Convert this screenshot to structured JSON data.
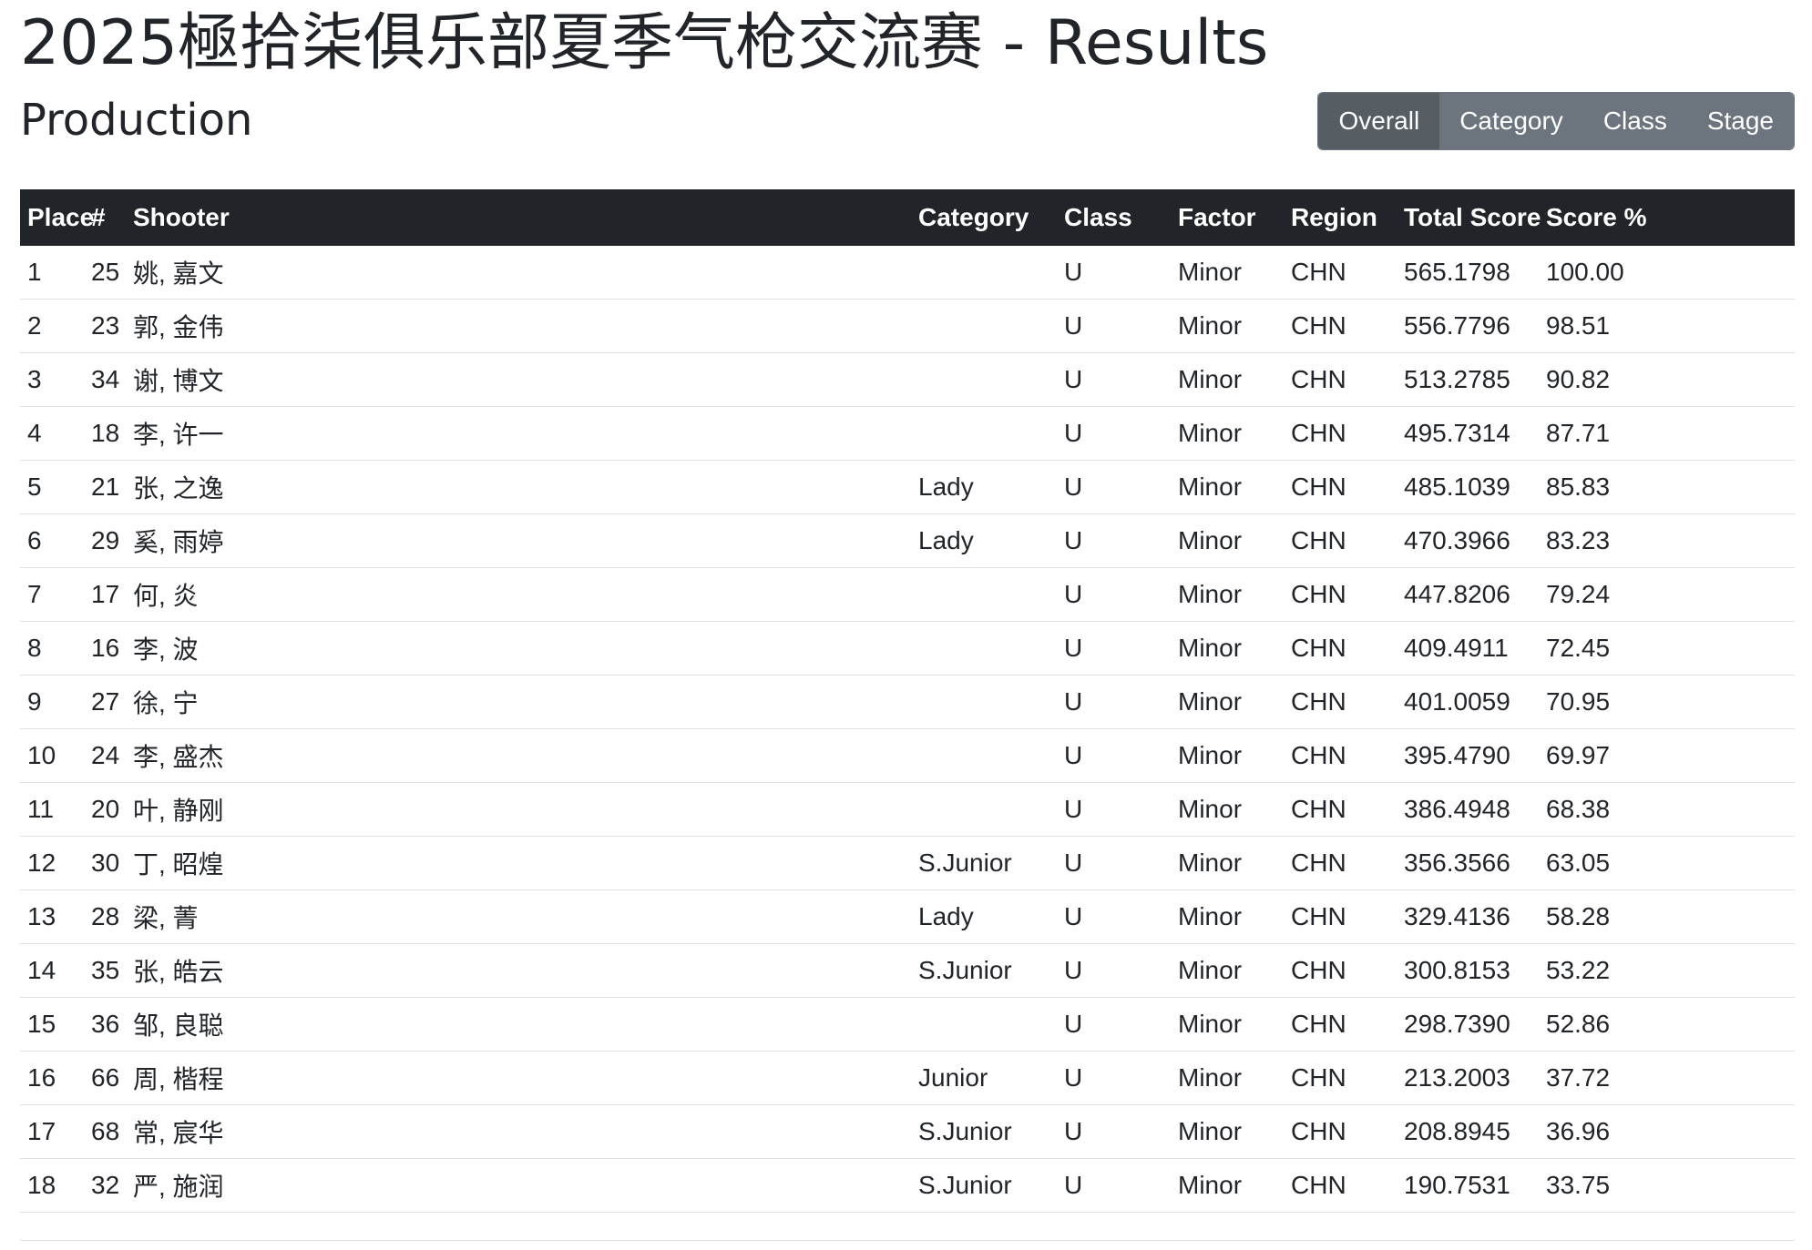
{
  "header": {
    "title": "2025極拾柒俱乐部夏季气枪交流赛 - Results",
    "subtitle": "Production"
  },
  "nav": {
    "buttons": [
      {
        "label": "Overall",
        "active": true
      },
      {
        "label": "Category",
        "active": false
      },
      {
        "label": "Class",
        "active": false
      },
      {
        "label": "Stage",
        "active": false
      }
    ]
  },
  "table": {
    "columns": [
      "Place",
      "#",
      "Shooter",
      "Category",
      "Class",
      "Factor",
      "Region",
      "Total Score",
      "Score %"
    ],
    "rows": [
      [
        "1",
        "25",
        "姚, 嘉文",
        "",
        "U",
        "Minor",
        "CHN",
        "565.1798",
        "100.00"
      ],
      [
        "2",
        "23",
        "郭, 金伟",
        "",
        "U",
        "Minor",
        "CHN",
        "556.7796",
        "98.51"
      ],
      [
        "3",
        "34",
        "谢, 博文",
        "",
        "U",
        "Minor",
        "CHN",
        "513.2785",
        "90.82"
      ],
      [
        "4",
        "18",
        "李, 许一",
        "",
        "U",
        "Minor",
        "CHN",
        "495.7314",
        "87.71"
      ],
      [
        "5",
        "21",
        "张, 之逸",
        "Lady",
        "U",
        "Minor",
        "CHN",
        "485.1039",
        "85.83"
      ],
      [
        "6",
        "29",
        "奚, 雨婷",
        "Lady",
        "U",
        "Minor",
        "CHN",
        "470.3966",
        "83.23"
      ],
      [
        "7",
        "17",
        "何, 炎",
        "",
        "U",
        "Minor",
        "CHN",
        "447.8206",
        "79.24"
      ],
      [
        "8",
        "16",
        "李, 波",
        "",
        "U",
        "Minor",
        "CHN",
        "409.4911",
        "72.45"
      ],
      [
        "9",
        "27",
        "徐, 宁",
        "",
        "U",
        "Minor",
        "CHN",
        "401.0059",
        "70.95"
      ],
      [
        "10",
        "24",
        "李, 盛杰",
        "",
        "U",
        "Minor",
        "CHN",
        "395.4790",
        "69.97"
      ],
      [
        "11",
        "20",
        "叶, 静刚",
        "",
        "U",
        "Minor",
        "CHN",
        "386.4948",
        "68.38"
      ],
      [
        "12",
        "30",
        "丁, 昭煌",
        "S.Junior",
        "U",
        "Minor",
        "CHN",
        "356.3566",
        "63.05"
      ],
      [
        "13",
        "28",
        "梁, 菁",
        "Lady",
        "U",
        "Minor",
        "CHN",
        "329.4136",
        "58.28"
      ],
      [
        "14",
        "35",
        "张, 皓云",
        "S.Junior",
        "U",
        "Minor",
        "CHN",
        "300.8153",
        "53.22"
      ],
      [
        "15",
        "36",
        "邹, 良聪",
        "",
        "U",
        "Minor",
        "CHN",
        "298.7390",
        "52.86"
      ],
      [
        "16",
        "66",
        "周, 楷程",
        "Junior",
        "U",
        "Minor",
        "CHN",
        "213.2003",
        "37.72"
      ],
      [
        "17",
        "68",
        "常, 宸华",
        "S.Junior",
        "U",
        "Minor",
        "CHN",
        "208.8945",
        "36.96"
      ],
      [
        "18",
        "32",
        "严, 施润",
        "S.Junior",
        "U",
        "Minor",
        "CHN",
        "190.7531",
        "33.75"
      ]
    ]
  },
  "colors": {
    "header_bg": "#212529",
    "button_bg": "#6c757d",
    "button_active_bg": "#565e64"
  }
}
